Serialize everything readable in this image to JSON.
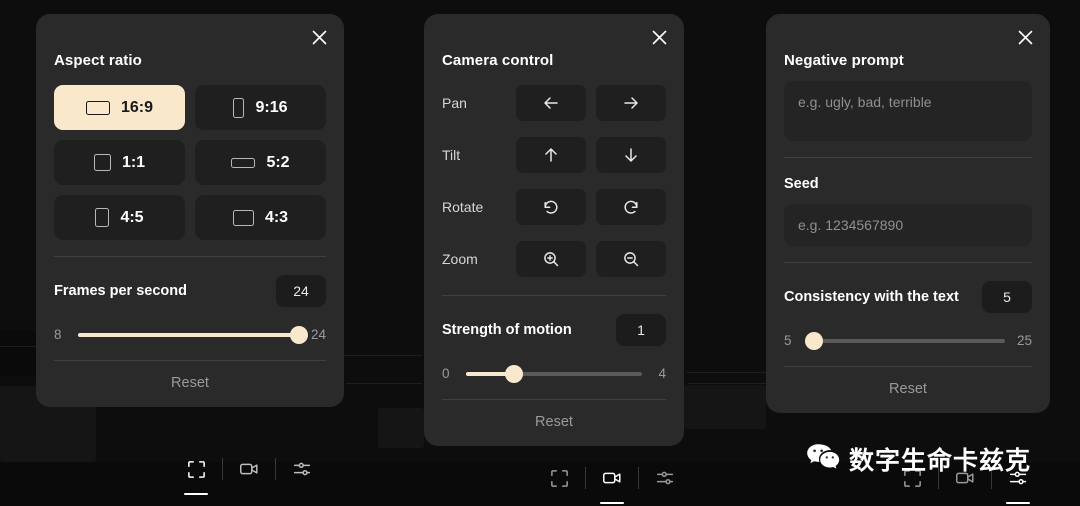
{
  "background": {
    "page_color": "#0d0d0d",
    "panel_color": "#2a2a2a",
    "accent_color": "#fae8cd"
  },
  "panels": [
    {
      "id": "aspect-ratio",
      "title": "Aspect ratio",
      "close_icon": "close-icon",
      "aspect_options": [
        {
          "label": "16:9",
          "icon": "rect-landscape-wide-icon",
          "selected": true
        },
        {
          "label": "9:16",
          "icon": "rect-portrait-tall-icon",
          "selected": false
        },
        {
          "label": "1:1",
          "icon": "rect-square-icon",
          "selected": false
        },
        {
          "label": "5:2",
          "icon": "rect-landscape-ultrawide-icon",
          "selected": false
        },
        {
          "label": "4:5",
          "icon": "rect-portrait-icon",
          "selected": false
        },
        {
          "label": "4:3",
          "icon": "rect-landscape-icon",
          "selected": false
        }
      ],
      "slider": {
        "label": "Frames per second",
        "value": "24",
        "min_label": "8",
        "max_label": "24",
        "percent": 100
      },
      "reset_label": "Reset"
    },
    {
      "id": "camera-control",
      "title": "Camera control",
      "close_icon": "close-icon",
      "controls": [
        {
          "name": "Pan",
          "buttons": [
            {
              "icon": "arrow-left-icon"
            },
            {
              "icon": "arrow-right-icon"
            }
          ]
        },
        {
          "name": "Tilt",
          "buttons": [
            {
              "icon": "arrow-up-icon"
            },
            {
              "icon": "arrow-down-icon"
            }
          ]
        },
        {
          "name": "Rotate",
          "buttons": [
            {
              "icon": "rotate-ccw-icon"
            },
            {
              "icon": "rotate-cw-icon"
            }
          ]
        },
        {
          "name": "Zoom",
          "buttons": [
            {
              "icon": "zoom-in-icon"
            },
            {
              "icon": "zoom-out-icon"
            }
          ]
        }
      ],
      "slider": {
        "label": "Strength of motion",
        "value": "1",
        "min_label": "0",
        "max_label": "4",
        "percent": 27
      },
      "reset_label": "Reset"
    },
    {
      "id": "negative-prompt",
      "title": "Negative prompt",
      "close_icon": "close-icon",
      "negative_prompt": {
        "value": "",
        "placeholder": "e.g. ugly, bad, terrible"
      },
      "seed": {
        "label": "Seed",
        "value": "",
        "placeholder": "e.g. 1234567890"
      },
      "slider": {
        "label": "Consistency with the text",
        "value": "5",
        "min_label": "5",
        "max_label": "25",
        "percent": 3
      },
      "reset_label": "Reset"
    }
  ],
  "toolbars": [
    {
      "id": "toolbar-left",
      "items": [
        {
          "icon": "fullscreen-frame-icon",
          "active": true
        },
        {
          "icon": "video-camera-icon",
          "active": false
        },
        {
          "icon": "sliders-icon",
          "active": false
        }
      ]
    },
    {
      "id": "toolbar-center",
      "items": [
        {
          "icon": "fullscreen-frame-icon",
          "active": false
        },
        {
          "icon": "video-camera-icon",
          "active": true
        },
        {
          "icon": "sliders-icon",
          "active": false
        }
      ]
    },
    {
      "id": "toolbar-right",
      "items": [
        {
          "icon": "fullscreen-frame-icon",
          "active": false
        },
        {
          "icon": "video-camera-icon",
          "active": false
        },
        {
          "icon": "sliders-icon",
          "active": true
        }
      ]
    }
  ],
  "watermark": {
    "icon": "wechat-logo-icon",
    "text": "数字生命卡兹克"
  }
}
